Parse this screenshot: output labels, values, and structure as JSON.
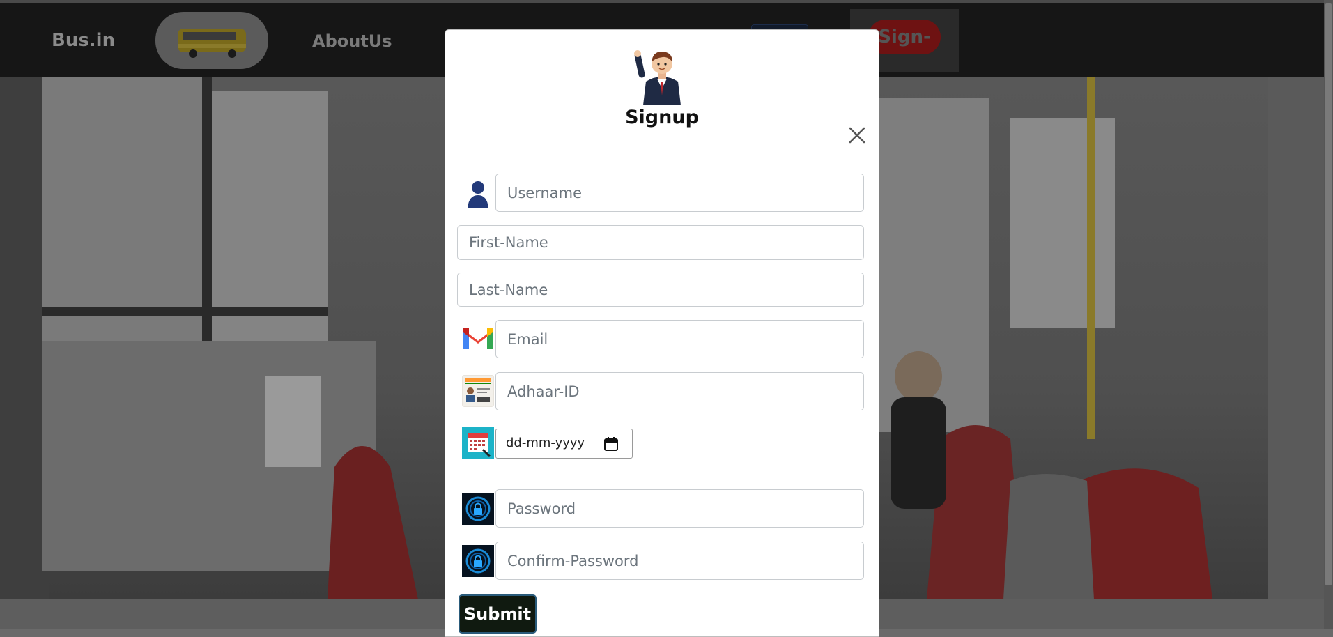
{
  "navbar": {
    "brand": "Bus.in",
    "about_label": "AboutUs",
    "signup_label": "Sign-up"
  },
  "modal": {
    "title": "Signup",
    "fields": {
      "username_placeholder": "Username",
      "firstname_placeholder": "First-Name",
      "lastname_placeholder": "Last-Name",
      "email_placeholder": "Email",
      "adhaar_placeholder": "Adhaar-ID",
      "dob_placeholder": "dd-mm-yyyy",
      "password_placeholder": "Password",
      "confirm_password_placeholder": "Confirm-Password"
    },
    "submit_label": "Submit"
  },
  "icons": {
    "avatar": "waving-businessman-icon",
    "username": "user-silhouette-icon",
    "email": "gmail-icon",
    "adhaar": "id-card-icon",
    "dob": "calendar-icon",
    "password": "lock-icon",
    "confirm_password": "lock-icon",
    "close": "close-icon"
  },
  "colors": {
    "navbar_bg": "#161616",
    "submit_bg": "#101a10",
    "signup_pill": "#6e1212"
  }
}
